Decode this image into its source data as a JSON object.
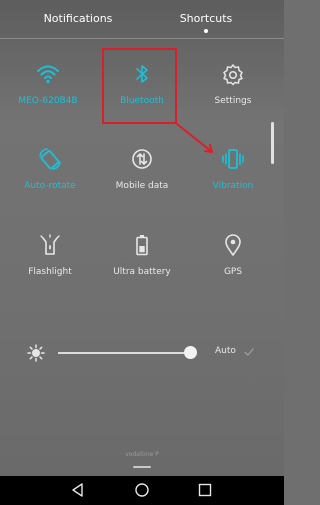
{
  "header": {
    "tabs": [
      {
        "label": "Notifications",
        "active": false
      },
      {
        "label": "Shortcuts",
        "active": true
      }
    ]
  },
  "tiles": [
    {
      "label": "MEO-620B4B",
      "icon": "wifi-icon",
      "active": true
    },
    {
      "label": "Bluetooth",
      "icon": "bluetooth-icon",
      "active": true,
      "highlighted": true
    },
    {
      "label": "Settings",
      "icon": "gear-icon",
      "active": false
    },
    {
      "label": "Auto-rotate",
      "icon": "auto-rotate-icon",
      "active": true
    },
    {
      "label": "Mobile data",
      "icon": "mobile-data-icon",
      "active": false
    },
    {
      "label": "Vibration",
      "icon": "vibration-icon",
      "active": true
    },
    {
      "label": "Flashlight",
      "icon": "flashlight-icon",
      "active": false
    },
    {
      "label": "Ultra battery",
      "icon": "battery-icon",
      "active": false
    },
    {
      "label": "GPS",
      "icon": "location-pin-icon",
      "active": false
    }
  ],
  "brightness": {
    "auto_label": "Auto",
    "level_fraction": 0.96,
    "auto_enabled": false
  },
  "footer": {
    "carrier": "vodafone P"
  },
  "colors": {
    "accent": "#18c2da",
    "highlight": "#d9202a",
    "inactive_icon": "#e6e6e6"
  }
}
